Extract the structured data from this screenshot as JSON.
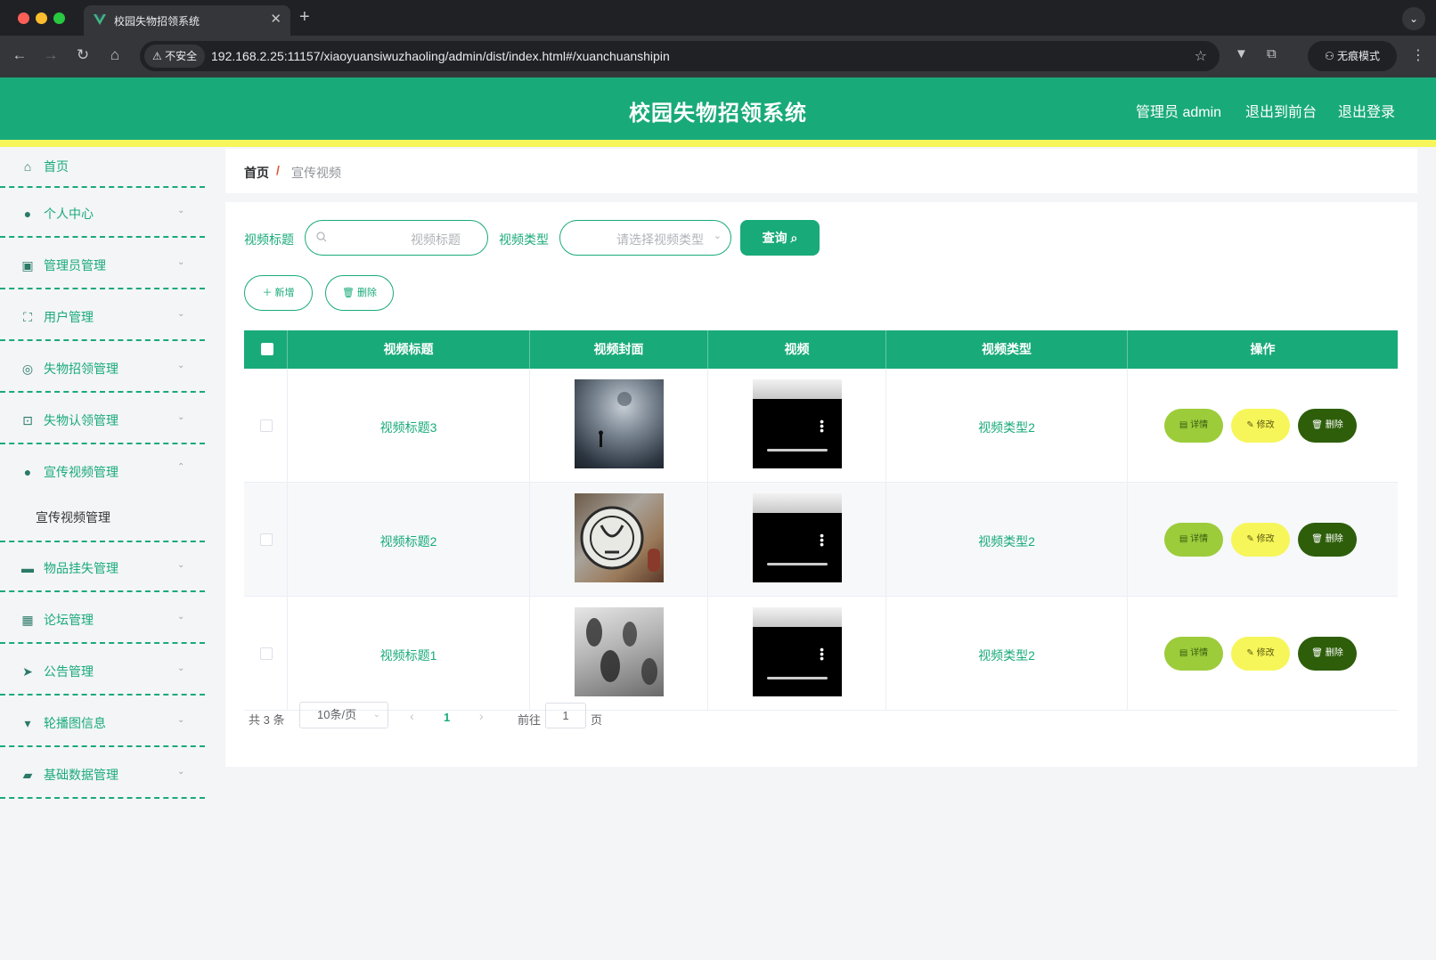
{
  "browser": {
    "tab_title": "校园失物招领系统",
    "secure_label": "不安全",
    "url": "192.168.2.25:11157/xiaoyuansiwuzhaoling/admin/dist/index.html#/xuanchuanshipin",
    "incognito_label": "无痕模式"
  },
  "header": {
    "title": "校园失物招领系统",
    "user": "管理员 admin",
    "to_front": "退出到前台",
    "logout": "退出登录",
    "brand_color": "#19aa7a",
    "accent_color": "#f6f65a"
  },
  "sidebar": {
    "items": [
      {
        "label": "首页",
        "icon": "home-icon"
      },
      {
        "label": "个人中心",
        "icon": "user-icon"
      },
      {
        "label": "管理员管理",
        "icon": "clipboard-icon"
      },
      {
        "label": "用户管理",
        "icon": "frame-icon"
      },
      {
        "label": "失物招领管理",
        "icon": "compass-icon"
      },
      {
        "label": "失物认领管理",
        "icon": "crop-icon"
      },
      {
        "label": "宣传视频管理",
        "icon": "user-icon",
        "expanded": true,
        "sub": "宣传视频管理"
      },
      {
        "label": "物品挂失管理",
        "icon": "briefcase-icon"
      },
      {
        "label": "论坛管理",
        "icon": "grid-icon"
      },
      {
        "label": "公告管理",
        "icon": "send-icon"
      },
      {
        "label": "轮播图信息",
        "icon": "brush-icon"
      },
      {
        "label": "基础数据管理",
        "icon": "ticket-icon"
      }
    ]
  },
  "breadcrumb": {
    "home": "首页",
    "sep": "/",
    "current": "宣传视频"
  },
  "filters": {
    "title_label": "视频标题",
    "title_placeholder": "视频标题",
    "type_label": "视频类型",
    "type_placeholder": "请选择视频类型",
    "query_label": "查询"
  },
  "actions": {
    "add_label": "新增",
    "delete_label": "删除"
  },
  "table": {
    "columns": [
      "视频标题",
      "视频封面",
      "视频",
      "视频类型",
      "操作"
    ],
    "rows": [
      {
        "title": "视频标题3",
        "type": "视频类型2",
        "cover": "cover-fog"
      },
      {
        "title": "视频标题2",
        "type": "视频类型2",
        "cover": "cover-seal"
      },
      {
        "title": "视频标题1",
        "type": "视频类型2",
        "cover": "cover-hands"
      }
    ],
    "row_actions": {
      "detail": "详情",
      "edit": "修改",
      "delete": "删除"
    }
  },
  "pagination": {
    "total": "共 3 条",
    "page_size": "10条/页",
    "current_page": "1",
    "goto_label": "前往",
    "goto_value": "1",
    "page_suffix": "页"
  }
}
